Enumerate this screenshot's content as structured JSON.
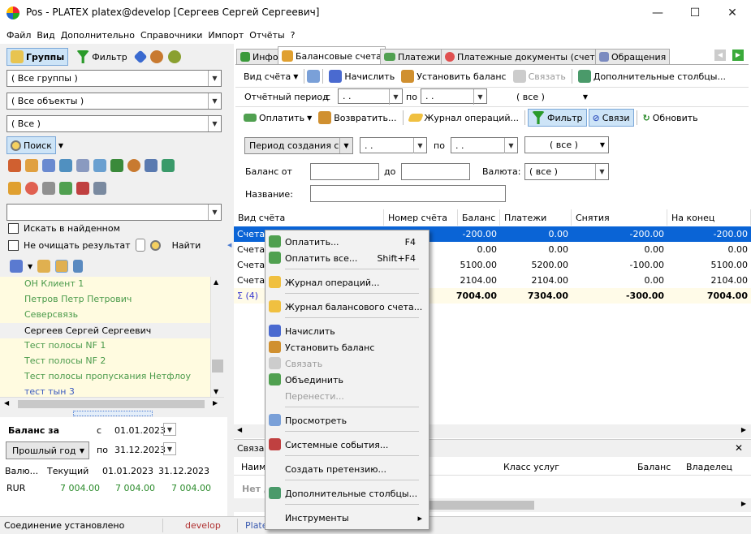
{
  "window": {
    "title": "Pos - PLATEX platex@develop [Сергеев Сергей Сергеевич]",
    "min": "—",
    "max": "☐",
    "close": "✕"
  },
  "menu": [
    "Файл",
    "Вид",
    "Дополнительно",
    "Справочники",
    "Импорт",
    "Отчёты",
    "?"
  ],
  "left": {
    "groups_label": "Группы",
    "filter_label": "Фильтр",
    "combo_groups": "( Все группы )",
    "combo_objects": "( Все объекты )",
    "combo_all": "( Все )",
    "search_label": "Поиск",
    "search_in_found": "Искать в найденном",
    "no_clear": "Не очищать результат",
    "find": "Найти",
    "list": [
      {
        "name": "ОН Клиент 1",
        "c": "#4a9a4a"
      },
      {
        "name": "Петров Петр Петрович",
        "c": "#4a9a4a"
      },
      {
        "name": "Северсвязь",
        "c": "#4a9a4a"
      },
      {
        "name": "Сергеев Сергей Сергеевич",
        "c": "#000"
      },
      {
        "name": "Тест полосы NF 1",
        "c": "#4a9a4a"
      },
      {
        "name": "Тест полосы NF 2",
        "c": "#4a9a4a"
      },
      {
        "name": "Тест полосы пропускания Нетфлоу",
        "c": "#4a9a4a"
      },
      {
        "name": "тест  тын  3",
        "c": "#3a5ac0"
      }
    ],
    "balance_label": "Баланс за",
    "from_lbl": "с",
    "to_lbl": "по",
    "date_from": "01.01.2023",
    "date_to": "31.12.2023",
    "period": "Прошлый год",
    "sum_headers": [
      "Валю...",
      "Текущий",
      "01.01.2023",
      "31.12.2023"
    ],
    "sum_row": [
      "RUR",
      "7 004.00",
      "7 004.00",
      "7 004.00"
    ]
  },
  "tabs": [
    "Инфо",
    "Балансовые счета",
    "Платежи",
    "Платежные документы (счета)",
    "Обращения"
  ],
  "toolbar1": {
    "view": "Вид счёта",
    "charge": "Начислить",
    "set_balance": "Установить баланс",
    "link": "Связать",
    "extra_cols": "Дополнительные столбцы..."
  },
  "toolbar2": {
    "period": "Отчётный период",
    "from": "с",
    "to": "по",
    "d1": ". .",
    "d2": ". .",
    "all": "( все )"
  },
  "toolbar3": {
    "pay": "Оплатить",
    "refund": "Возвратить...",
    "journal": "Журнал операций...",
    "filter": "Фильтр",
    "links": "Связи",
    "refresh": "Обновить"
  },
  "filter": {
    "period_type": "Период создания с",
    "d1": ". .",
    "to": "по",
    "d2": ". .",
    "all": "( все )",
    "balance_from": "Баланс от",
    "to2": "до",
    "currency": "Валюта:",
    "currency_val": "( все )",
    "name": "Название:"
  },
  "grid": {
    "headers": [
      "Вид счёта",
      "Номер счёта",
      "Баланс",
      "Платежи",
      "Снятия",
      "На конец"
    ],
    "rows": [
      {
        "c0": "Счета",
        "c1": "",
        "c2": "-200.00",
        "c3": "0.00",
        "c4": "-200.00",
        "c5": "-200.00"
      },
      {
        "c0": "Счета",
        "c1": "",
        "c2": "0.00",
        "c3": "0.00",
        "c4": "0.00",
        "c5": "0.00"
      },
      {
        "c0": "Счета",
        "c1": "",
        "c2": "5100.00",
        "c3": "5200.00",
        "c4": "-100.00",
        "c5": "5100.00"
      },
      {
        "c0": "Счета",
        "c1": "",
        "c2": "2104.00",
        "c3": "2104.00",
        "c4": "0.00",
        "c5": "2104.00"
      }
    ],
    "total": {
      "c0": "Σ  (4)",
      "c2": "7004.00",
      "c3": "7304.00",
      "c4": "-300.00",
      "c5": "7004.00"
    }
  },
  "links_panel": {
    "title": "Связан",
    "cols": [
      "Наим",
      "Класс услуг",
      "Баланс",
      "Владелец"
    ],
    "empty": "Нет д"
  },
  "context_menu": [
    {
      "label": "Оплатить...",
      "sc": "F4",
      "dis": false
    },
    {
      "label": "Оплатить все...",
      "sc": "Shift+F4",
      "dis": false
    },
    {
      "label": "Журнал операций...",
      "sc": "",
      "dis": false
    },
    {
      "label": "Журнал балансового счета...",
      "sc": "",
      "dis": false
    },
    {
      "label": "Начислить",
      "sc": "",
      "dis": false
    },
    {
      "label": "Установить баланс",
      "sc": "",
      "dis": false
    },
    {
      "label": "Связать",
      "sc": "",
      "dis": true
    },
    {
      "label": "Объединить",
      "sc": "",
      "dis": false
    },
    {
      "label": "Перенести...",
      "sc": "",
      "dis": true
    },
    {
      "label": "Просмотреть",
      "sc": "",
      "dis": false
    },
    {
      "label": "Системные события...",
      "sc": "",
      "dis": false
    },
    {
      "label": "Создать претензию...",
      "sc": "",
      "dis": false
    },
    {
      "label": "Дополнительные столбцы...",
      "sc": "",
      "dis": false
    },
    {
      "label": "Инструменты",
      "sc": "▸",
      "dis": false
    }
  ],
  "status": {
    "conn": "Соединение установлено",
    "env": "develop",
    "app": "Platex"
  }
}
